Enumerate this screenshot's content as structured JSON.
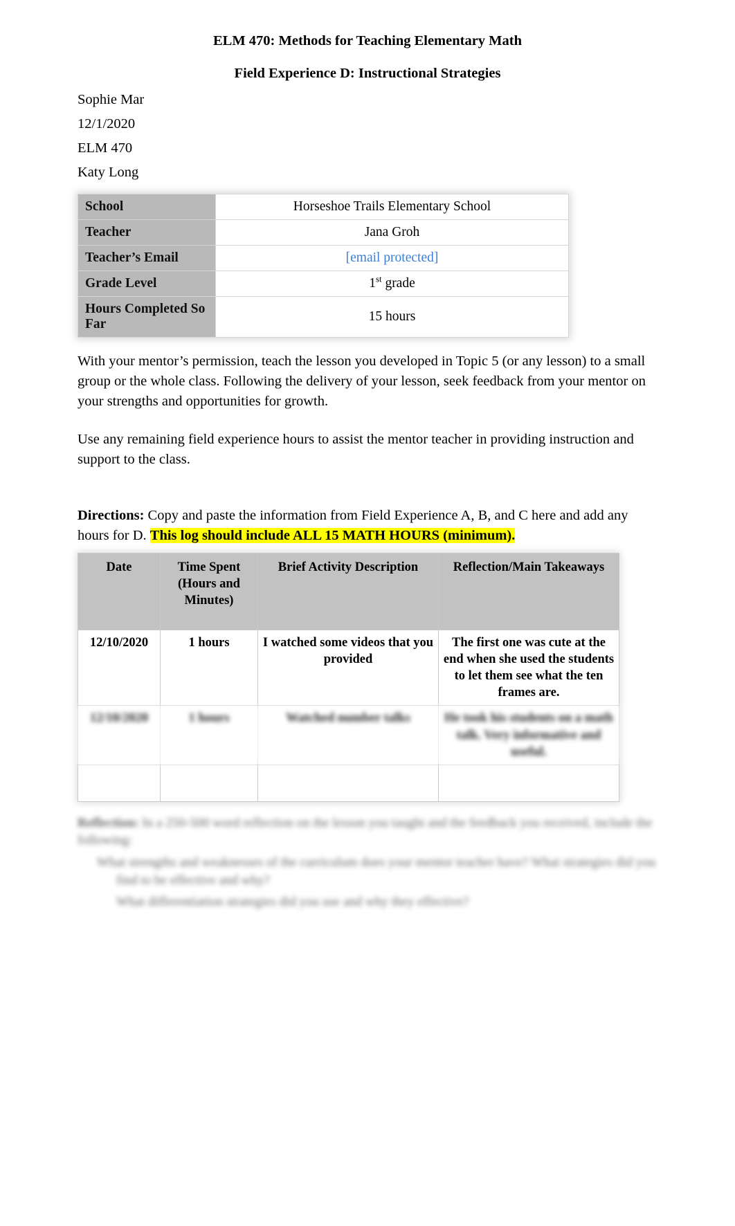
{
  "document": {
    "title": "ELM 470: Methods for Teaching Elementary Math",
    "subtitle": "Field Experience D: Instructional Strategies"
  },
  "header_meta": {
    "student_name": "Sophie Mar",
    "date": "12/1/2020",
    "course": "ELM 470",
    "instructor": "Katy Long"
  },
  "info_table": {
    "rows": [
      {
        "label": "School",
        "value": "Horseshoe Trails Elementary School",
        "type": "text"
      },
      {
        "label": "Teacher",
        "value": "Jana Groh",
        "type": "text"
      },
      {
        "label": "Teacher’s Email",
        "value": "[email protected]",
        "type": "link"
      },
      {
        "label": "Grade Level",
        "value": "1st grade",
        "value_number": "1",
        "value_ordinal": "st",
        "value_suffix": " grade",
        "type": "ordinal"
      },
      {
        "label": "Hours Completed So Far",
        "value": "15 hours",
        "type": "text"
      }
    ]
  },
  "body": {
    "paragraph_1": "With your mentor’s permission, teach the lesson you developed in Topic 5 (or any lesson) to a small group or the whole class. Following the delivery of your lesson, seek feedback from your mentor on your strengths and opportunities for growth.",
    "paragraph_2": "Use any remaining field experience hours to assist the mentor teacher in providing instruction and support to the class."
  },
  "directions": {
    "label": "Directions:",
    "text": " Copy and paste the information from Field Experience A, B, and C here and add any hours for D. ",
    "highlight": "This log should include ALL 15 MATH HOURS (minimum)."
  },
  "log_table": {
    "headers": [
      "Date",
      "Time Spent (Hours and Minutes)",
      "Brief Activity Description",
      "Reflection/Main Takeaways"
    ],
    "headers_lines": {
      "date": "Date",
      "time_line1": "Time Spent",
      "time_line2": "(Hours and",
      "time_line3": "Minutes)",
      "description": "Brief Activity Description",
      "reflection": "Reflection/Main Takeaways"
    },
    "rows": [
      {
        "date": "12/10/2020",
        "time": "1 hours",
        "description": "I watched some videos that you provided",
        "reflection": "The first one was cute at the end when she used the students to let them see what the ten frames are.",
        "blurred": false
      },
      {
        "date": "12/10/2020",
        "time": "1 hours",
        "description": "Watched number talks",
        "reflection": "He took his students on a math talk. Very informative and useful.",
        "blurred": true
      },
      {
        "date": "",
        "time": "",
        "description": "",
        "reflection": "",
        "blurred": false
      }
    ]
  },
  "footer": {
    "label": "Reflection:",
    "line_1": "In a 250-500 word reflection on the lesson you taught and the feedback you received, include the following:",
    "bullet_1": "What strengths and weaknesses of the curriculum does your mentor teacher have? What strategies did you find to be effective and why?",
    "bullet_2": "What differentiation strategies did you use and why they effective?"
  },
  "colors": {
    "highlight": "#ffff00",
    "link": "#3b7dd8",
    "info_label_bg": "#b9b9b9",
    "table_header_bg": "#c2c2c2"
  }
}
